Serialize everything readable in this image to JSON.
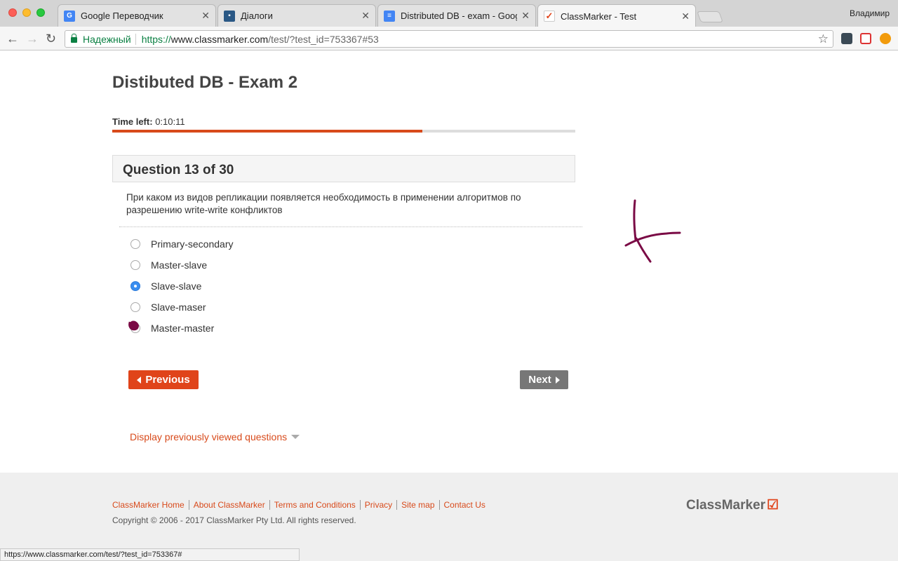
{
  "browser": {
    "tabs": [
      {
        "title": "Google Переводчик",
        "icon": "google-translate-icon",
        "color": "#4285f4",
        "glyph": "G"
      },
      {
        "title": "Діалоги",
        "icon": "chat-icon",
        "color": "#2a5885",
        "glyph": "▪"
      },
      {
        "title": "Distributed DB - exam - Googl",
        "icon": "docs-icon",
        "color": "#4285f4",
        "glyph": "≡"
      },
      {
        "title": "ClassMarker - Test",
        "icon": "classmarker-icon",
        "color": "#e0441a",
        "glyph": "✓"
      }
    ],
    "active_tab": 3,
    "profile_name": "Владимир",
    "secure_label": "Надежный",
    "url_scheme": "https://",
    "url_host": "www.classmarker.com",
    "url_path": "/test/?test_id=753367#53",
    "status_url": "https://www.classmarker.com/test/?test_id=753367#"
  },
  "exam": {
    "title": "Distibuted DB - Exam 2",
    "time_left_label": "Time left:",
    "time_left_value": "0:10:11",
    "progress_fraction": 0.67,
    "question_heading": "Question 13 of 30",
    "question_text": "При каком из видов репликации появляется необходимость в применении алгоритмов по разрешению write-write конфликтов",
    "options": [
      {
        "label": "Primary-secondary",
        "checked": false
      },
      {
        "label": "Master-slave",
        "checked": false
      },
      {
        "label": "Slave-slave",
        "checked": true
      },
      {
        "label": "Slave-maser",
        "checked": false
      },
      {
        "label": "Master-master",
        "checked": false
      }
    ],
    "prev_label": "Previous",
    "next_label": "Next",
    "viewed_questions_label": "Display previously viewed questions"
  },
  "footer": {
    "links": [
      "ClassMarker Home",
      "About ClassMarker",
      "Terms and Conditions",
      "Privacy",
      "Site map",
      "Contact Us"
    ],
    "copyright": "Copyright © 2006 - 2017 ClassMarker Pty Ltd. All rights reserved.",
    "brand": "ClassMarker"
  },
  "colors": {
    "accent": "#e0441a",
    "selected_radio": "#3a8ef0",
    "doodle": "#7a0a45"
  }
}
